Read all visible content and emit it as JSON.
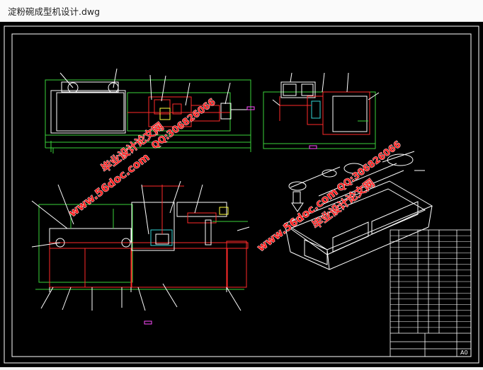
{
  "window": {
    "title": "淀粉碗成型机设计.dwg"
  },
  "watermarks": [
    {
      "id": "left-site",
      "text": "www.56doc.com"
    },
    {
      "id": "left-name",
      "text": "毕业设计论文网"
    },
    {
      "id": "left-qq",
      "text": "QQ:306826066"
    },
    {
      "id": "right-site",
      "text": "www.56doc.com"
    },
    {
      "id": "right-name",
      "text": "毕业设计论文网"
    },
    {
      "id": "right-qq",
      "text": "QQ:306826066"
    }
  ],
  "title_block": {
    "sheet_size": "A0"
  },
  "colors": {
    "background": "#000000",
    "frame": "#ffffff",
    "green": "#3ad23a",
    "red": "#ff2a2a",
    "cyan": "#35d6d6",
    "yellow": "#ffff40",
    "magenta": "#ff4dff",
    "watermark": "#ff1f1f"
  }
}
